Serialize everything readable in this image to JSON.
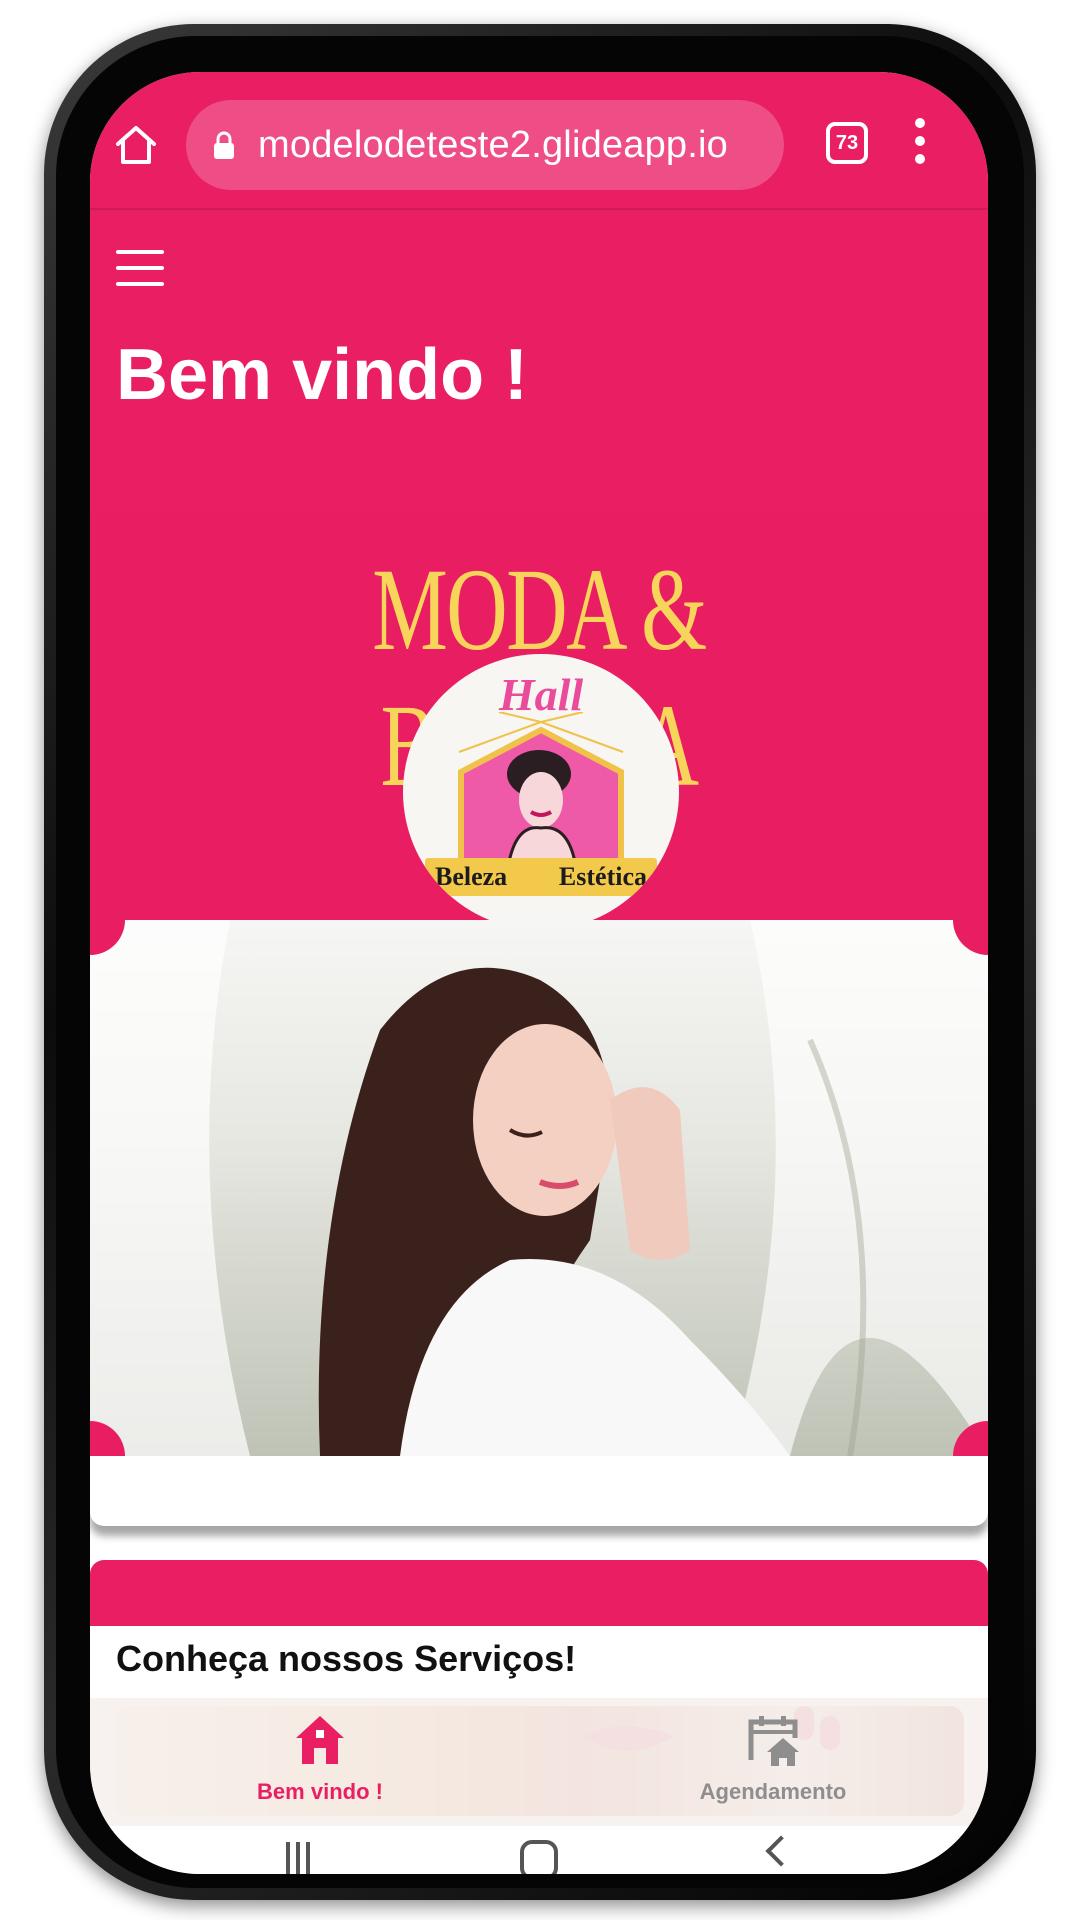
{
  "browser": {
    "url": "modelodeteste2.glideapp.io",
    "tab_count": "73"
  },
  "header": {
    "title": "Bem vindo !"
  },
  "banner": {
    "title": "MODA & BELEZA",
    "logo_top": "Hall",
    "logo_left": "Beleza",
    "logo_right": "Estética"
  },
  "services": {
    "title": "Conheça nossos Serviços!"
  },
  "bottom_nav": {
    "items": [
      {
        "label": "Bem vindo !",
        "icon": "home-icon",
        "active": true
      },
      {
        "label": "Agendamento",
        "icon": "calendar-home-icon",
        "active": false
      }
    ]
  },
  "colors": {
    "primary": "#e91e63",
    "banner_text": "#f7d55a",
    "inactive": "#8e8e8e"
  }
}
